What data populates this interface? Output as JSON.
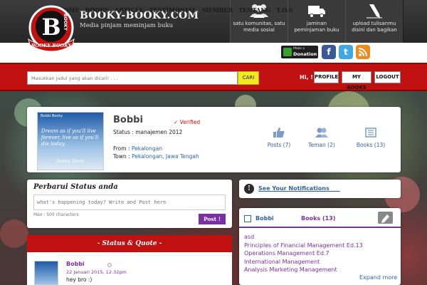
{
  "brand": {
    "title": "BOOKY-BOOKY.COM",
    "tagline": "Media pinjam meminjam buku",
    "badge_letter": "B",
    "badge_word": "BOOKY",
    "badge_ribbon": "BOOKY BOOKY"
  },
  "features": [
    {
      "label": "satu komunitas, satu media sosial",
      "icon": "users-icon"
    },
    {
      "label": "jaminan peminjaman buku",
      "icon": "truck-icon"
    },
    {
      "label": "upload tulisanmu disini dan bagikan",
      "icon": "pen-icon"
    }
  ],
  "nav": {
    "items": [
      "HOME",
      "BOOKS",
      "ARTICLE",
      "TESTIMONIAL",
      "MEMBER",
      "TENTANG",
      "T.O.S"
    ],
    "donate_small": "Make a",
    "donate_label": "Donation"
  },
  "social": {
    "facebook": "f",
    "twitter": "t"
  },
  "search": {
    "placeholder": "Masukkan judul yang akan dicari! . . .",
    "button": "CARI"
  },
  "user_bar": {
    "greeting": "Hi, !",
    "profile": "PROFILE",
    "my_books": "MY BOOKS",
    "logout": "LOGOUT"
  },
  "profile": {
    "name": "Bobbi",
    "verified": "✓ Verified",
    "status": "Status : manajemen 2012",
    "from_label": "From : ",
    "from_value": "Pekalongan",
    "town_label": "Town : ",
    "town_value": "Pekalongan, Jawa Tengah",
    "photo_caption": "Bobbi Booky",
    "photo_quote": "Dream as if you'll live forever, live as if you'll die today.",
    "photo_sign": "James Dean"
  },
  "stats": [
    {
      "label": "Posts (7)",
      "icon": "thumbs-up-icon"
    },
    {
      "label": "Teman (2)",
      "icon": "friends-icon"
    },
    {
      "label": "Books (13)",
      "icon": "books-icon"
    }
  ],
  "status_box": {
    "title": "Perbarui Status anda",
    "placeholder": "what's happening today? Write and Post here",
    "max_note": "Max : 500 characters",
    "post_button": "Post !"
  },
  "status_quote": {
    "title": "- Status & Quote -",
    "item": {
      "name": "Bobbi",
      "date": "22 Januari 2015, 12:32pm",
      "text": "hey bro :)"
    }
  },
  "notifications": {
    "icon_letter": "!",
    "label": "See Your Notifications ___"
  },
  "books_panel": {
    "name": "Bobbi",
    "count": "Books (13)",
    "items": [
      "asd",
      "Principles of Financial Management Ed.13",
      "Operations Management Ed.7",
      "International Management",
      "Analysis Marketing Management"
    ],
    "expand": "Expand more"
  },
  "colors": {
    "brand_red": "#c01010",
    "accent_purple": "#7b2fa5",
    "link_blue": "#2f63a8",
    "search_yellow": "#f2e820"
  }
}
